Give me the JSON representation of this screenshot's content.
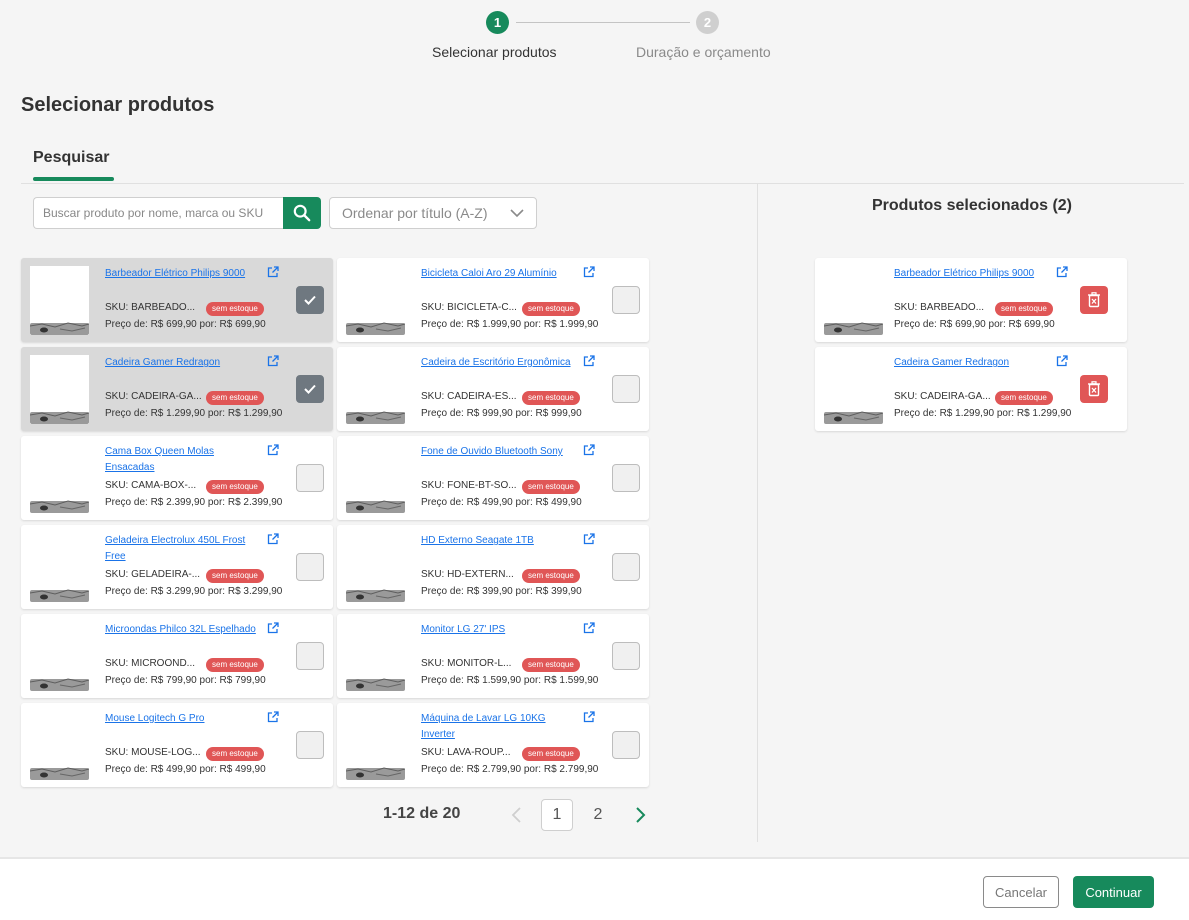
{
  "stepper": {
    "steps": [
      {
        "number": "1",
        "label": "Selecionar produtos",
        "status": "active"
      },
      {
        "number": "2",
        "label": "Duração e orçamento",
        "status": "inactive"
      }
    ]
  },
  "page": {
    "title": "Selecionar produtos"
  },
  "tabs": [
    {
      "label": "Pesquisar",
      "active": true
    }
  ],
  "search": {
    "placeholder": "Buscar produto por nome, marca ou SKU",
    "value": ""
  },
  "sort": {
    "label": "Ordenar por título (A-Z)"
  },
  "colors": {
    "accent": "#178a5c",
    "badge": "#e05656",
    "link": "#1a73e8"
  },
  "products": [
    {
      "name": "Barbeador Elétrico Philips 9000",
      "sku": "SKU: BARBEADO...",
      "badge": "sem estoque",
      "price": "Preço de: R$ 699,90 por: R$ 699,90",
      "selected": true
    },
    {
      "name": "Bicicleta Caloi Aro 29 Alumínio",
      "sku": "SKU: BICICLETA-C...",
      "badge": "sem estoque",
      "price": "Preço de: R$ 1.999,90 por: R$ 1.999,90",
      "selected": false
    },
    {
      "name": "Cadeira Gamer Redragon",
      "sku": "SKU: CADEIRA-GA...",
      "badge": "sem estoque",
      "price": "Preço de: R$ 1.299,90 por: R$ 1.299,90",
      "selected": true
    },
    {
      "name": "Cadeira de Escritório Ergonômica",
      "sku": "SKU: CADEIRA-ES...",
      "badge": "sem estoque",
      "price": "Preço de: R$ 999,90 por: R$ 999,90",
      "selected": false
    },
    {
      "name": "Cama Box Queen Molas Ensacadas",
      "sku": "SKU: CAMA-BOX-...",
      "badge": "sem estoque",
      "price": "Preço de: R$ 2.399,90 por: R$ 2.399,90",
      "selected": false
    },
    {
      "name": "Fone de Ouvido Bluetooth Sony",
      "sku": "SKU: FONE-BT-SO...",
      "badge": "sem estoque",
      "price": "Preço de: R$ 499,90 por: R$ 499,90",
      "selected": false
    },
    {
      "name": "Geladeira Electrolux 450L Frost Free",
      "sku": "SKU: GELADEIRA-...",
      "badge": "sem estoque",
      "price": "Preço de: R$ 3.299,90 por: R$ 3.299,90",
      "selected": false
    },
    {
      "name": "HD Externo Seagate 1TB",
      "sku": "SKU: HD-EXTERN...",
      "badge": "sem estoque",
      "price": "Preço de: R$ 399,90 por: R$ 399,90",
      "selected": false
    },
    {
      "name": "Microondas Philco 32L Espelhado",
      "sku": "SKU: MICROOND...",
      "badge": "sem estoque",
      "price": "Preço de: R$ 799,90 por: R$ 799,90",
      "selected": false
    },
    {
      "name": "Monitor LG 27' IPS",
      "sku": "SKU: MONITOR-L...",
      "badge": "sem estoque",
      "price": "Preço de: R$ 1.599,90 por: R$ 1.599,90",
      "selected": false
    },
    {
      "name": "Mouse Logitech G Pro",
      "sku": "SKU: MOUSE-LOG...",
      "badge": "sem estoque",
      "price": "Preço de: R$ 499,90 por: R$ 499,90",
      "selected": false
    },
    {
      "name": "Máquina de Lavar LG 10KG Inverter",
      "sku": "SKU: LAVA-ROUP...",
      "badge": "sem estoque",
      "price": "Preço de: R$ 2.799,90 por: R$ 2.799,90",
      "selected": false
    }
  ],
  "pagination": {
    "range": "1-12 de 20",
    "pages": [
      "1",
      "2"
    ],
    "current": "1"
  },
  "selected_panel": {
    "title": "Produtos selecionados (2)",
    "items": [
      {
        "name": "Barbeador Elétrico Philips 9000",
        "sku": "SKU: BARBEADO...",
        "badge": "sem estoque",
        "price": "Preço de: R$ 699,90 por: R$ 699,90"
      },
      {
        "name": "Cadeira Gamer Redragon",
        "sku": "SKU: CADEIRA-GA...",
        "badge": "sem estoque",
        "price": "Preço de: R$ 1.299,90 por: R$ 1.299,90"
      }
    ]
  },
  "footer": {
    "cancel_label": "Cancelar",
    "continue_label": "Continuar"
  }
}
